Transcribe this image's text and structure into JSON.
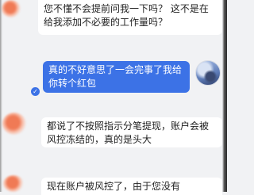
{
  "messages": [
    {
      "side": "in",
      "text": "您不懂不会提前问我一下吗？ 这不是在给我添加不必要的工作量吗？"
    },
    {
      "side": "out",
      "text": "真的不好意思了一会完事了我给你转个红包"
    },
    {
      "side": "in",
      "text": "都说了不按照指示分笔提现，账户会被风控冻结的，真的是头大"
    },
    {
      "side": "in",
      "text": "现在账户被风控了，由于您没有"
    }
  ],
  "icons": {
    "check": "check-icon",
    "avatar_other": "avatar-blurred",
    "avatar_self": "avatar-self"
  },
  "colors": {
    "background": "#f1f2f4",
    "incoming_bubble": "#ffffff",
    "outgoing_bubble": "#3c72e6"
  }
}
